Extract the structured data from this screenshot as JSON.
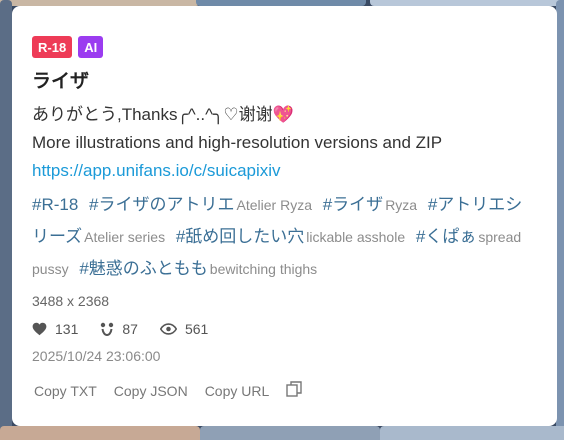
{
  "badges": {
    "r18": "R-18",
    "ai": "AI"
  },
  "title": "ライザ",
  "description": {
    "line1": "ありがとう,Thanks╭^..^╮♡谢谢",
    "heart": "💖",
    "line2": "More illustrations and high-resolution versions and ZIP"
  },
  "link": "https://app.unifans.io/c/suicapixiv",
  "tags": [
    {
      "tag": "#R-18",
      "translation": ""
    },
    {
      "tag": "#ライザのアトリエ",
      "translation": "Atelier Ryza"
    },
    {
      "tag": "#ライザ",
      "translation": "Ryza"
    },
    {
      "tag": "#アトリエシリーズ",
      "translation": "Atelier series"
    },
    {
      "tag": "#舐め回したい穴",
      "translation": "lickable asshole"
    },
    {
      "tag": "#くぱぁ",
      "translation": "spread pussy"
    },
    {
      "tag": "#魅惑のふともも",
      "translation": "bewitching thighs"
    }
  ],
  "dimensions": "3488 x 2368",
  "stats": {
    "likes": "131",
    "bookmarks": "87",
    "views": "561"
  },
  "date": "2025/10/24 23:06:00",
  "actions": {
    "copy_txt": "Copy TXT",
    "copy_json": "Copy JSON",
    "copy_url": "Copy URL"
  },
  "icons": [
    "heart-icon",
    "bookmark-icon",
    "eye-icon",
    "copy-icon"
  ],
  "colors": {
    "r18": "#ee3b57",
    "ai": "#9b3cf0",
    "link": "#1b9ad8",
    "tag": "#3b6f95"
  }
}
